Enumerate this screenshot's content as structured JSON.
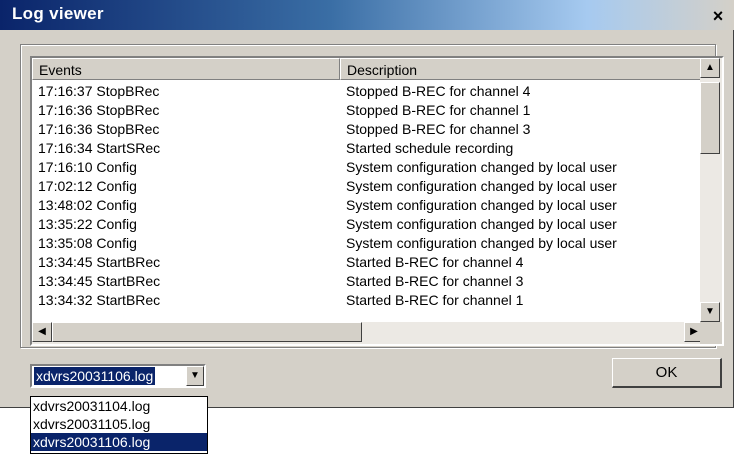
{
  "window": {
    "title": "Log viewer",
    "close_glyph": "×"
  },
  "list": {
    "columns": [
      "Events",
      "Description"
    ],
    "rows": [
      {
        "event": "17:16:37 StopBRec",
        "description": "Stopped B-REC for channel 4"
      },
      {
        "event": "17:16:36 StopBRec",
        "description": "Stopped B-REC for channel 1"
      },
      {
        "event": "17:16:36 StopBRec",
        "description": "Stopped B-REC for channel 3"
      },
      {
        "event": "17:16:34 StartSRec",
        "description": "Started schedule recording"
      },
      {
        "event": "17:16:10 Config",
        "description": "System configuration changed by local user"
      },
      {
        "event": "17:02:12 Config",
        "description": "System configuration changed by local user"
      },
      {
        "event": "13:48:02 Config",
        "description": "System configuration changed by local user"
      },
      {
        "event": "13:35:22 Config",
        "description": "System configuration changed by local user"
      },
      {
        "event": "13:35:08 Config",
        "description": "System configuration changed by local user"
      },
      {
        "event": "13:34:45 StartBRec",
        "description": "Started B-REC for channel 4"
      },
      {
        "event": "13:34:45 StartBRec",
        "description": "Started B-REC for channel 3"
      },
      {
        "event": "13:34:32 StartBRec",
        "description": "Started B-REC for channel 1"
      }
    ],
    "scroll_up_glyph": "▲",
    "scroll_down_glyph": "▼",
    "scroll_left_glyph": "◀",
    "scroll_right_glyph": "▶"
  },
  "log_select": {
    "selected": "xdvrs20031106.log",
    "arrow_glyph": "▼",
    "options": [
      "xdvrs20031104.log",
      "xdvrs20031105.log",
      "xdvrs20031106.log"
    ]
  },
  "ok_label": "OK",
  "colors": {
    "selection": "#0a246a",
    "dialog_bg": "#d4d0c8"
  }
}
